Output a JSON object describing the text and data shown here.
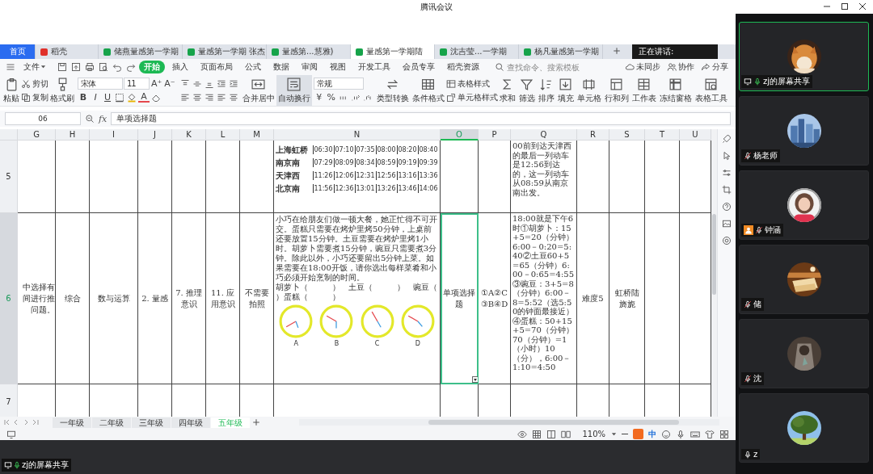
{
  "window": {
    "title": "腾讯会议"
  },
  "shared_screen": {
    "doc_tabs": [
      {
        "label": "首页",
        "kind": "home",
        "selected": false
      },
      {
        "label": "稻壳",
        "kind": "app",
        "selected": false
      },
      {
        "label": "储燕量感第一学期",
        "kind": "sheet",
        "selected": false
      },
      {
        "label": "量感第一学期 张杰",
        "kind": "sheet",
        "selected": false
      },
      {
        "label": "量感第...慧雅)",
        "kind": "sheet",
        "selected": false
      },
      {
        "label": "量感第一学期陆",
        "kind": "sheet",
        "selected": true
      },
      {
        "label": "沈吉莹...一学期",
        "kind": "sheet",
        "selected": false
      },
      {
        "label": "杨凡量感第一学期",
        "kind": "sheet",
        "selected": false
      }
    ],
    "speaking": "正在讲话:",
    "file_menu": "文件",
    "menu": [
      {
        "label": "开始",
        "selected": true
      },
      {
        "label": "插入",
        "selected": false
      },
      {
        "label": "页面布局",
        "selected": false
      },
      {
        "label": "公式",
        "selected": false
      },
      {
        "label": "数据",
        "selected": false
      },
      {
        "label": "审阅",
        "selected": false
      },
      {
        "label": "视图",
        "selected": false
      },
      {
        "label": "开发工具",
        "selected": false
      },
      {
        "label": "会员专享",
        "selected": false
      },
      {
        "label": "稻壳资源",
        "selected": false
      }
    ],
    "search": {
      "placeholder": "查找命令、搜索模板"
    },
    "menu_actions": [
      "未同步",
      "协作",
      "分享"
    ],
    "ribbon": [
      {
        "kind": "big",
        "label": "粘贴",
        "selected": false
      },
      {
        "kind": "pair",
        "labels": [
          "剪切",
          "复制"
        ]
      },
      {
        "kind": "big",
        "label": "格式刷",
        "selected": false
      },
      {
        "kind": "font",
        "font": "宋体",
        "size": "11",
        "size_steps": [
          "A⁺",
          "A⁻"
        ],
        "styles": [
          "B",
          "I",
          "U"
        ],
        "color_letter": "A"
      },
      {
        "kind": "align"
      },
      {
        "kind": "big",
        "label": "合并居中",
        "selected": false
      },
      {
        "kind": "big",
        "label": "自动换行",
        "selected": true
      },
      {
        "kind": "number",
        "format": "常规",
        "symbols": [
          "¥",
          "%"
        ]
      },
      {
        "kind": "big",
        "label": "类型转换",
        "selected": false
      },
      {
        "kind": "big",
        "label": "条件格式",
        "selected": false
      },
      {
        "kind": "pair",
        "labels": [
          "表格样式",
          "单元格样式"
        ]
      },
      {
        "kind": "big",
        "label": "求和",
        "selected": false
      },
      {
        "kind": "big",
        "label": "筛选",
        "selected": false
      },
      {
        "kind": "big",
        "label": "排序",
        "selected": false
      },
      {
        "kind": "big",
        "label": "填充",
        "selected": false
      },
      {
        "kind": "big",
        "label": "单元格",
        "selected": false
      },
      {
        "kind": "big",
        "label": "行和列",
        "selected": false
      },
      {
        "kind": "big",
        "label": "工作表",
        "selected": false
      },
      {
        "kind": "big",
        "label": "冻结窗格",
        "selected": false
      },
      {
        "kind": "big",
        "label": "表格工具",
        "selected": false
      }
    ],
    "name_box": {
      "value": "06"
    },
    "formula": {
      "label": "fx",
      "value": "单项选择题"
    },
    "columns": [
      {
        "label": "G",
        "selected": false
      },
      {
        "label": "H",
        "selected": false
      },
      {
        "label": "I",
        "selected": false
      },
      {
        "label": "J",
        "selected": false
      },
      {
        "label": "K",
        "selected": false
      },
      {
        "label": "L",
        "selected": false
      },
      {
        "label": "M",
        "selected": false
      },
      {
        "label": "N",
        "selected": false
      },
      {
        "label": "O",
        "selected": true
      },
      {
        "label": "P",
        "selected": false
      },
      {
        "label": "Q",
        "selected": false
      },
      {
        "label": "R",
        "selected": false
      },
      {
        "label": "S",
        "selected": false
      },
      {
        "label": "T",
        "selected": false
      },
      {
        "label": "U",
        "selected": false
      }
    ],
    "rows": [
      {
        "header": "5",
        "selected": false,
        "cells": [
          null,
          null,
          null,
          null,
          null,
          null,
          null,
          {
            "kind": "timetable",
            "rows": [
              [
                "上海虹桥",
                "06:30",
                "07:10",
                "07:35",
                "08:00",
                "08:20",
                "08:40"
              ],
              [
                "南京南",
                "07:29",
                "08:09",
                "08:34",
                "08:59",
                "09:19",
                "09:39"
              ],
              [
                "天津西",
                "11:26",
                "12:06",
                "12:31",
                "12:56",
                "13:16",
                "13:36"
              ],
              [
                "北京南",
                "11:56",
                "12:36",
                "13:01",
                "13:26",
                "13:46",
                "14:06"
              ]
            ]
          },
          null,
          null,
          {
            "kind": "para",
            "text": "00前到达天津西的最后一列动车是12:56到达的，这一列动车从08:59从南京南出发。"
          },
          null,
          null,
          null,
          null
        ]
      },
      {
        "header": "6",
        "selected": true,
        "cells": [
          {
            "kind": "lines",
            "lines": [
              "中选择有",
              "间进行推",
              "问题。"
            ]
          },
          {
            "kind": "text",
            "text": "综合"
          },
          {
            "kind": "text",
            "text": "数与运算"
          },
          {
            "kind": "text",
            "text": "2. 量感"
          },
          {
            "kind": "text",
            "text": "7. 推理意识"
          },
          {
            "kind": "text",
            "text": "11. 应用意识"
          },
          {
            "kind": "text",
            "text": "不需要拍照"
          },
          {
            "kind": "question",
            "text": "小巧在给朋友们做一顿大餐，她正忙得不可开交。蛋糕只需要在烤炉里烤50分钟，上桌前还要放置15分钟。土豆需要在烤炉里烤1小时。胡萝卜需要煮15分钟，豌豆只需要煮3分钟。除此以外，小巧还要留出5分钟上菜。如果需要在18:00开饭，请你选出每样菜肴和小巧必须开始烹制的时间。",
            "blanks": [
              "胡萝卜（　　　）　土豆（　　　）　豌豆（",
              "）蛋糕（　　　）"
            ],
            "clocks": [
              "A",
              "B",
              "C",
              "D"
            ]
          },
          {
            "kind": "text",
            "text": "单项选择题"
          },
          {
            "kind": "text",
            "text": "①A②C③B④D"
          },
          {
            "kind": "para",
            "text": "18:00就是下午6时①胡萝卜：15+5=20（分钟）6:00－0:20=5:40②土豆60+5=65（分钟）6:00－0:65=4:55③豌豆：3+5=8（分钟）6:00－8=5:52（选5:50的钟面最接近）④蛋糕：50+15+5=70（分钟）70（分钟）=1（小时）10（分），6:00－1:10=4:50"
          },
          {
            "kind": "text",
            "text": "难度5"
          },
          {
            "kind": "text",
            "text": "虹桥陆旖旎"
          },
          null,
          null
        ]
      },
      {
        "header": "7",
        "selected": false,
        "cells": [
          null,
          null,
          null,
          null,
          null,
          null,
          null,
          null,
          null,
          null,
          null,
          null,
          null,
          null,
          null
        ]
      }
    ],
    "sheet_tabs": [
      {
        "label": "一年级",
        "selected": false
      },
      {
        "label": "二年级",
        "selected": false
      },
      {
        "label": "三年级",
        "selected": false
      },
      {
        "label": "四年级",
        "selected": false
      },
      {
        "label": "五年级",
        "selected": true
      }
    ],
    "zoom": "110%",
    "ime": "中"
  },
  "participants": [
    {
      "name": "zj的屏幕共享",
      "speaking": true,
      "sharing": true,
      "host": false,
      "muted": false
    },
    {
      "name": "杨老师",
      "speaking": false,
      "sharing": false,
      "host": false,
      "muted": true
    },
    {
      "name": "钟涵",
      "speaking": false,
      "sharing": false,
      "host": true,
      "muted": true
    },
    {
      "name": "储",
      "speaking": false,
      "sharing": false,
      "host": false,
      "muted": true
    },
    {
      "name": "沈",
      "speaking": false,
      "sharing": false,
      "host": false,
      "muted": true
    },
    {
      "name": "z",
      "speaking": false,
      "sharing": false,
      "host": false,
      "muted": false
    }
  ],
  "share_label": "zj的屏幕共享"
}
